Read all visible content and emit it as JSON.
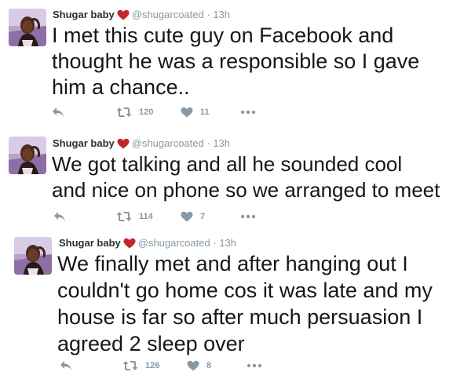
{
  "tweets": [
    {
      "name": "Shugar baby",
      "handle": "@shugarcoated",
      "separator": "·",
      "time": "13h",
      "text_lines": [
        "I met this cute guy on Facebook and",
        "thought he was a responsible so I gave",
        "him a chance.."
      ],
      "retweets": "120",
      "likes": "11"
    },
    {
      "name": "Shugar baby",
      "handle": "@shugarcoated",
      "separator": "·",
      "time": "13h",
      "text_lines": [
        "We got talking and all he sounded cool",
        "and nice on phone so we arranged to meet"
      ],
      "retweets": "114",
      "likes": "7"
    },
    {
      "name": "Shugar baby",
      "handle": "@shugarcoated",
      "separator": "·",
      "time": "13h",
      "text_lines": [
        "We finally met and after hanging out I",
        "couldn't go home cos it was late and my",
        "house is far so after much persuasion I",
        "agreed 2 sleep over"
      ],
      "retweets": "126",
      "likes": "8"
    }
  ],
  "colors": {
    "heart": "#c0272d",
    "icon": "#8899a6"
  },
  "icons": [
    "reply-icon",
    "retweet-icon",
    "like-icon",
    "more-icon",
    "red-heart-emoji"
  ]
}
